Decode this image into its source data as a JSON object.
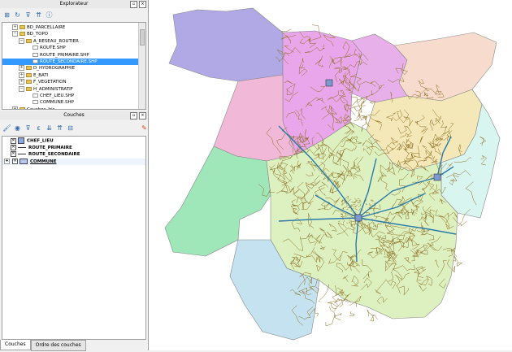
{
  "explorer": {
    "title": "Explorateur",
    "tree": [
      {
        "label": "BD_PARCELLAIRE",
        "level": 1,
        "type": "folder",
        "exp": "+"
      },
      {
        "label": "BD_TOPO",
        "level": 1,
        "type": "folder",
        "exp": "−"
      },
      {
        "label": "A_RESEAU_ROUTIER",
        "level": 2,
        "type": "folder",
        "exp": "−"
      },
      {
        "label": "ROUTE.SHP",
        "level": 3,
        "type": "file"
      },
      {
        "label": "ROUTE_PRIMAIRE.SHP",
        "level": 3,
        "type": "file"
      },
      {
        "label": "ROUTE_SECONDAIRE.SHP",
        "level": 3,
        "type": "file",
        "selected": true
      },
      {
        "label": "D_HYDROGRAPHIE",
        "level": 2,
        "type": "folder",
        "exp": "+"
      },
      {
        "label": "E_BATI",
        "level": 2,
        "type": "folder",
        "exp": "+"
      },
      {
        "label": "F_VEGETATION",
        "level": 2,
        "type": "folder",
        "exp": "+"
      },
      {
        "label": "H_ADMINISTRATIF",
        "level": 2,
        "type": "folder",
        "exp": "−"
      },
      {
        "label": "CHEF_LIEU.SHP",
        "level": 3,
        "type": "file"
      },
      {
        "label": "COMMUNE.SHP",
        "level": 3,
        "type": "file"
      },
      {
        "label": "Couches_Iris",
        "level": 1,
        "type": "folder",
        "exp": "+"
      }
    ]
  },
  "layers_panel": {
    "title": "Couches",
    "layers": [
      {
        "label": "CHEF_LIEU",
        "symbol": "point"
      },
      {
        "label": "ROUTE_PRIMAIRE",
        "symbol": "line"
      },
      {
        "label": "ROUTE_SECONDAIRE",
        "symbol": "line"
      },
      {
        "label": "COMMUNE",
        "symbol": "polygon",
        "underline": true
      }
    ]
  },
  "tabs": [
    "Couches",
    "Ordre des couches"
  ],
  "colors": {
    "selection": "#3399ff",
    "commune_fills": [
      "#b1a8e6",
      "#eaa6ea",
      "#e8b0ea",
      "#f7dccd",
      "#f2b8d8",
      "#f4e8b8",
      "#d8f5f0",
      "#9fe6b8",
      "#dcf0c0",
      "#c4e2f0"
    ],
    "route_secondaire": "#8b6d1e",
    "route_primaire": "#2b7aa8"
  }
}
